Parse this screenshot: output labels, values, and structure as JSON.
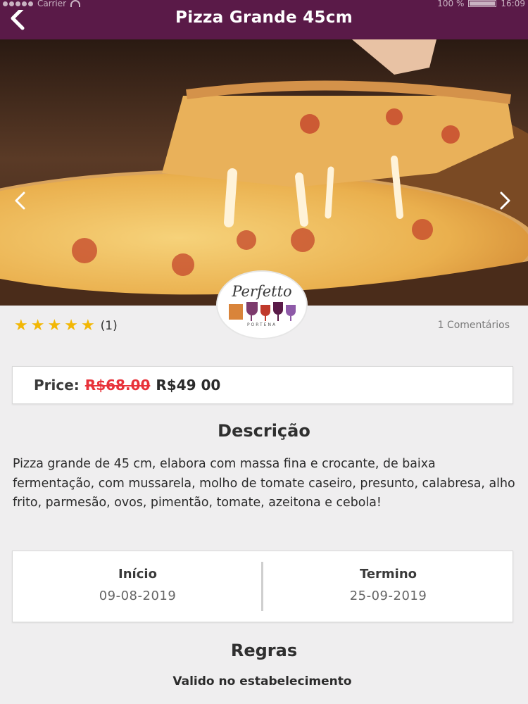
{
  "status_bar": {
    "carrier": "Carrier",
    "battery": "100 %",
    "time": "16:09"
  },
  "nav": {
    "title": "Pizza Grande 45cm",
    "back_icon": "chevron-left-icon",
    "bar_color": "#5a1a48"
  },
  "gallery": {
    "prev_icon": "chevron-left-icon",
    "next_icon": "chevron-right-icon"
  },
  "store_logo": {
    "brand": "Perfetto",
    "subtitle": "PORTENA"
  },
  "rating": {
    "stars": 5,
    "max_stars": 5,
    "count": "(1)",
    "comments": "1 Comentários"
  },
  "price": {
    "label": "Price:",
    "old": "R$68.00",
    "new": "R$49 00",
    "old_color": "#e8323a"
  },
  "description": {
    "title": "Descrição",
    "text": "Pizza grande de 45 cm, elabora com massa fina e crocante, de baixa fermentação, com mussarela, molho de tomate caseiro, presunto, calabresa, alho frito, parmesão, ovos, pimentão, tomate, azeitona e cebola!"
  },
  "dates": {
    "start_label": "Início",
    "start_value": "09-08-2019",
    "end_label": "Termino",
    "end_value": "25-09-2019"
  },
  "rules": {
    "title": "Regras",
    "text": "Valido no estabelecimento"
  }
}
